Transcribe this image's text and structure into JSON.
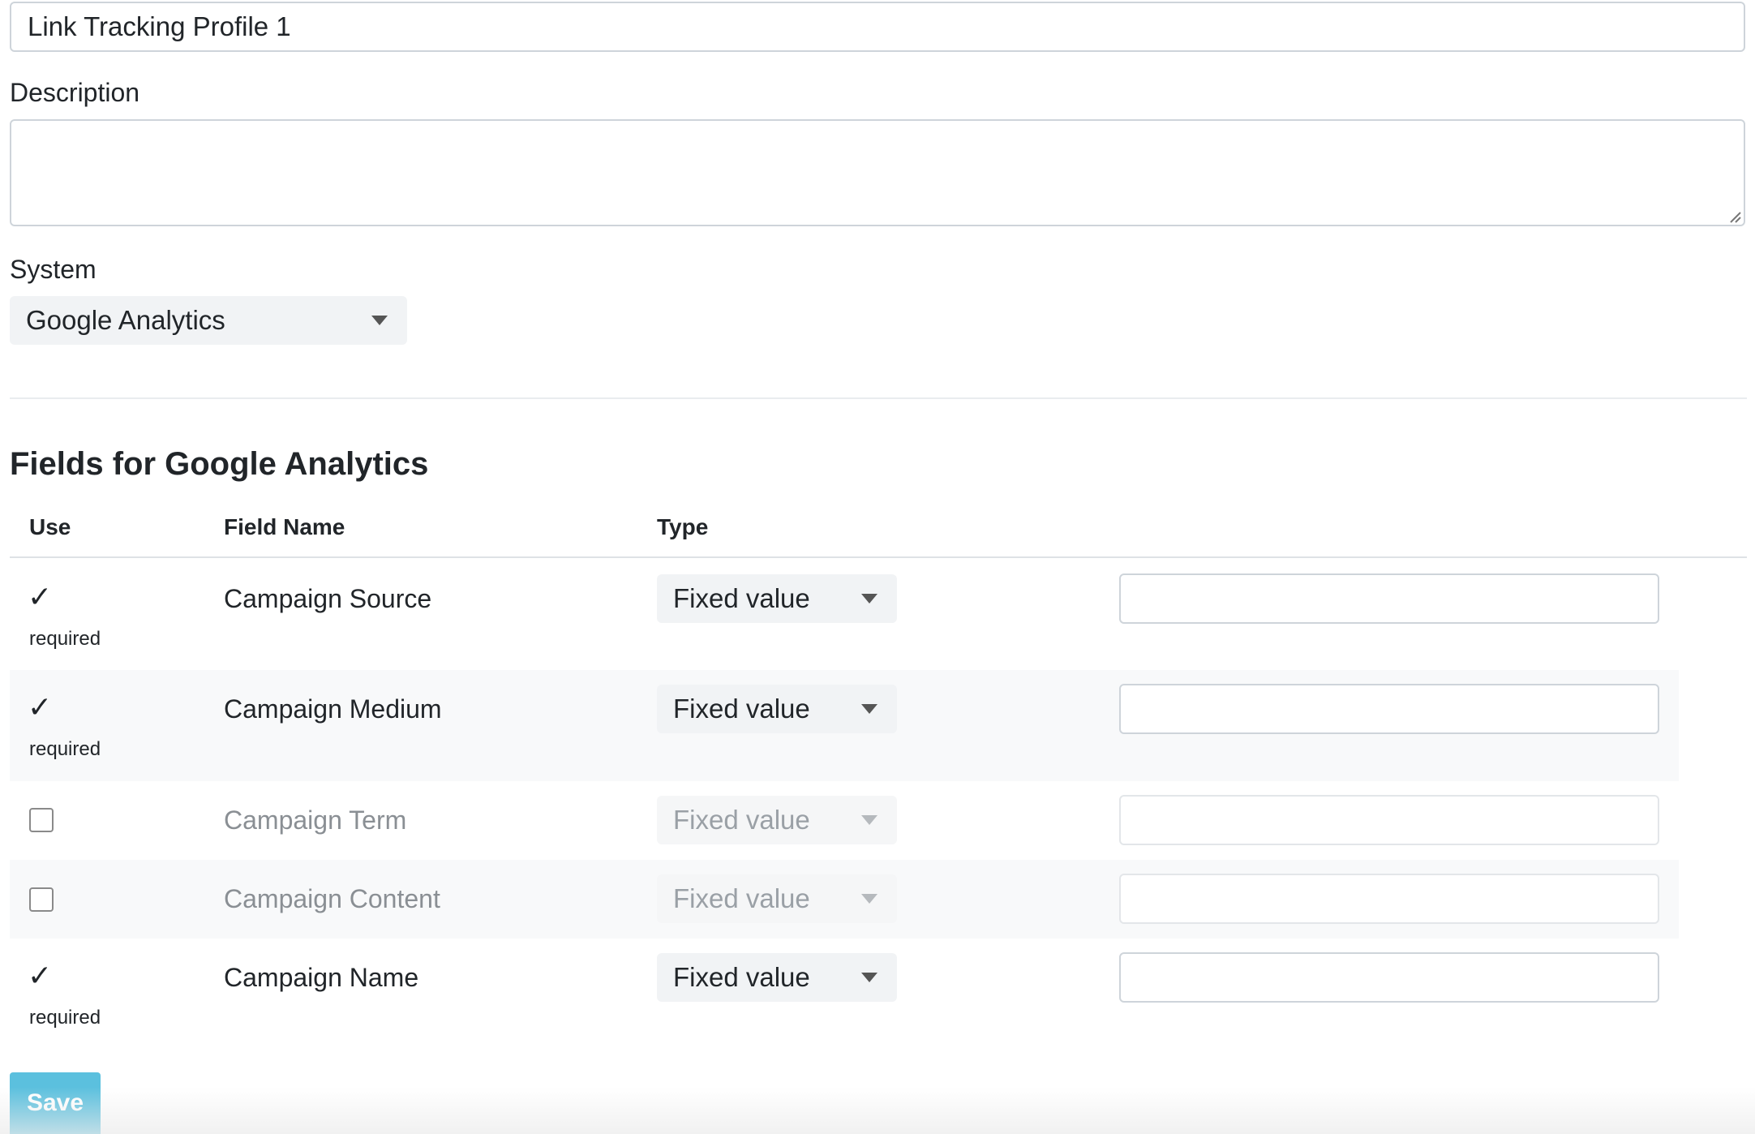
{
  "form": {
    "name_value": "Link Tracking Profile 1",
    "description_label": "Description",
    "description_value": "",
    "system_label": "System",
    "system_selected": "Google Analytics"
  },
  "fields_section": {
    "title": "Fields for Google Analytics",
    "columns": [
      "Use",
      "Field Name",
      "Type"
    ],
    "rows": [
      {
        "checked": true,
        "required": true,
        "required_label": "required",
        "field_name": "Campaign Source",
        "type": "Fixed value",
        "value": "",
        "enabled": true
      },
      {
        "checked": true,
        "required": true,
        "required_label": "required",
        "field_name": "Campaign Medium",
        "type": "Fixed value",
        "value": "",
        "enabled": true
      },
      {
        "checked": false,
        "required": false,
        "field_name": "Campaign Term",
        "type": "Fixed value",
        "value": "",
        "enabled": false
      },
      {
        "checked": false,
        "required": false,
        "field_name": "Campaign Content",
        "type": "Fixed value",
        "value": "",
        "enabled": false
      },
      {
        "checked": true,
        "required": true,
        "required_label": "required",
        "field_name": "Campaign Name",
        "type": "Fixed value",
        "value": "",
        "enabled": true
      }
    ]
  },
  "actions": {
    "save_label": "Save"
  },
  "icons": {
    "check": "check-mark-icon",
    "caret": "caret-down-icon",
    "resize": "resize-grip-icon"
  },
  "colors": {
    "save_button": "#5bc0de",
    "select_bg": "#f1f3f5",
    "stripe_bg": "#f8f9fa",
    "disabled_text": "#8a8f94"
  }
}
